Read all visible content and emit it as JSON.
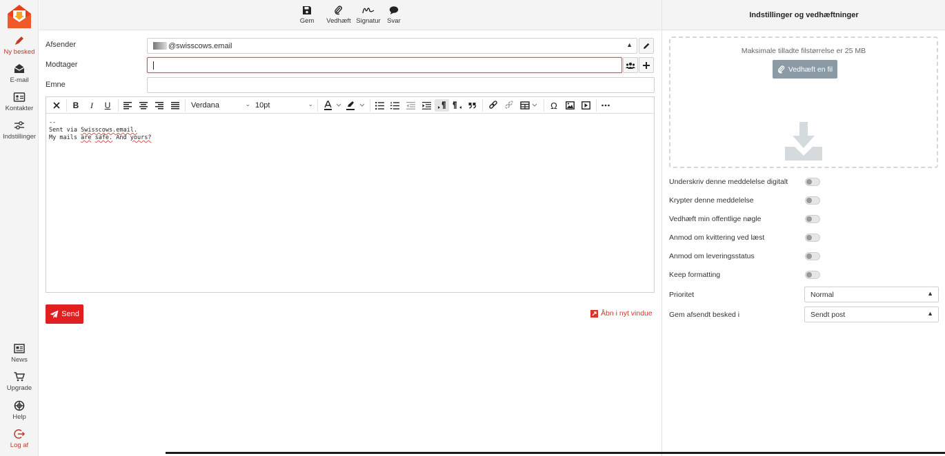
{
  "sidebar": {
    "top_items": [
      {
        "label": "Ny besked",
        "icon": "pen-icon",
        "active": true
      },
      {
        "label": "E-mail",
        "icon": "envelope-icon"
      },
      {
        "label": "Kontakter",
        "icon": "contact-card-icon"
      },
      {
        "label": "Indstillinger",
        "icon": "sliders-icon"
      }
    ],
    "bottom_items": [
      {
        "label": "News",
        "icon": "newspaper-icon"
      },
      {
        "label": "Upgrade",
        "icon": "cart-icon"
      },
      {
        "label": "Help",
        "icon": "lifebuoy-icon"
      },
      {
        "label": "Log af",
        "icon": "logout-icon"
      }
    ]
  },
  "toolbar": {
    "save": "Gem",
    "attach": "Vedhæft",
    "signature": "Signatur",
    "reply": "Svar"
  },
  "compose": {
    "from_label": "Afsender",
    "from_value": "@swisscows.email",
    "to_label": "Modtager",
    "to_value": "",
    "subject_label": "Emne",
    "subject_value": ""
  },
  "editor": {
    "font": "Verdana",
    "size": "10pt",
    "body_lines": [
      "--",
      "Sent via Swisscows.email.",
      "My mails are safe. And yours?"
    ]
  },
  "actions": {
    "send": "Send",
    "open_new_window": "Åbn i nyt vindue"
  },
  "panel": {
    "title": "Indstillinger og vedhæftninger",
    "max_size_text": "Maksimale tilladte filstørrelse er 25 MB",
    "attach_button": "Vedhæft en fil",
    "options": [
      {
        "label": "Underskriv denne meddelelse digitalt",
        "enabled": false
      },
      {
        "label": "Krypter denne meddelelse",
        "enabled": false
      },
      {
        "label": "Vedhæft min offentlige nøgle",
        "enabled": false
      },
      {
        "label": "Anmod om kvittering ved læst",
        "enabled": false
      },
      {
        "label": "Anmod om leveringsstatus",
        "enabled": false
      },
      {
        "label": "Keep formatting",
        "enabled": false
      }
    ],
    "priority_label": "Prioritet",
    "priority_value": "Normal",
    "save_sent_label": "Gem afsendt besked i",
    "save_sent_value": "Sendt post"
  },
  "colors": {
    "accent": "#e02020",
    "attach_button": "#8a9ba5",
    "sidebar_bg": "#f4f4f4"
  }
}
